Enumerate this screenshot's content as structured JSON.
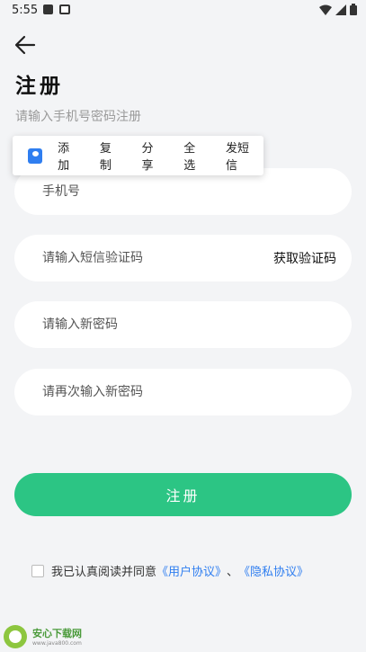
{
  "status_bar": {
    "time": "5:55"
  },
  "header": {
    "title": "注册",
    "subtitle": "请输入手机号密码注册"
  },
  "context_menu": {
    "items": [
      "添加",
      "复制",
      "分享",
      "全选",
      "发短信"
    ]
  },
  "form": {
    "phone_placeholder": "手机号",
    "sms_placeholder": "请输入短信验证码",
    "get_code_label": "获取验证码",
    "password_placeholder": "请输入新密码",
    "confirm_placeholder": "请再次输入新密码"
  },
  "submit_label": "注册",
  "agreement": {
    "prefix": "我已认真阅读并同意",
    "user_agreement": "《用户协议》",
    "separator": "、",
    "privacy_policy": "《隐私协议》",
    "checked": false
  },
  "watermark": {
    "name": "安心下载网",
    "url": "www.java800.com"
  },
  "colors": {
    "accent": "#2cc584",
    "link": "#2f7ef0",
    "background": "#f3f4f6"
  }
}
